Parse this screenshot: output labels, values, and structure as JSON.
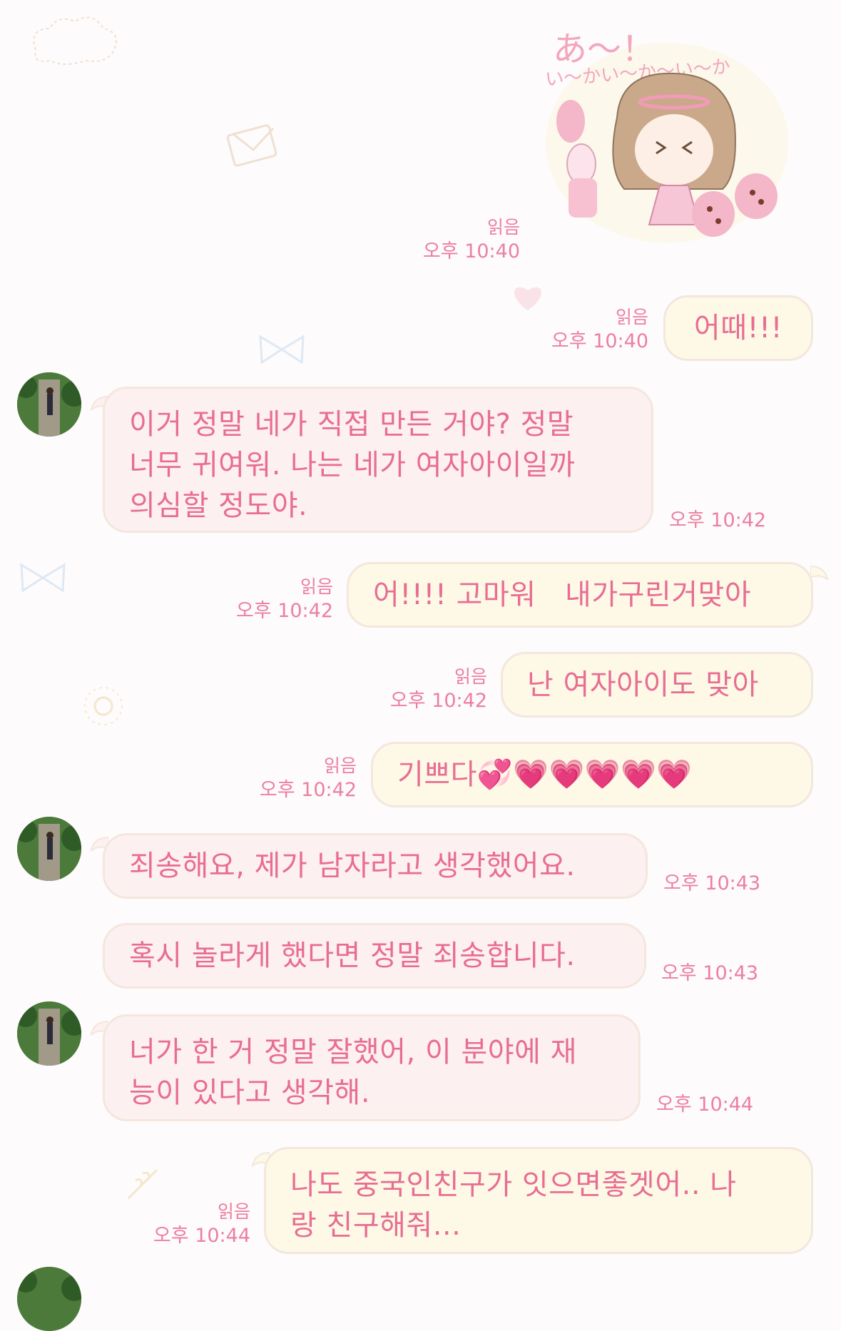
{
  "colors": {
    "text_pink": "#e86d93",
    "meta_pink": "#ec7fa2",
    "outgoing_bg": "#fdf9e6",
    "incoming_bg": "#fdf0f1",
    "bubble_border": "#f3e7de"
  },
  "sticker": {
    "caption_top": "あ〜！",
    "caption": "い〜かい〜か〜い〜か"
  },
  "messages": [
    {
      "id": "m0",
      "side": "out",
      "type": "sticker",
      "read": "읽음",
      "time": "오후 10:40"
    },
    {
      "id": "m1",
      "side": "out",
      "text": "어때!!!",
      "read": "읽음",
      "time": "오후 10:40"
    },
    {
      "id": "m2",
      "side": "in",
      "lines": [
        "이거 정말 네가 직접 만든 거야? 정말",
        "너무 귀여워. 나는 네가 여자아이일까",
        "의심할 정도야."
      ],
      "time": "오후 10:42"
    },
    {
      "id": "m3",
      "side": "out",
      "text": "어!!!! 고마워　내가구린거맞아",
      "read": "읽음",
      "time": "오후 10:42"
    },
    {
      "id": "m4",
      "side": "out",
      "text": "난 여자아이도 맞아",
      "read": "읽음",
      "time": "오후 10:42"
    },
    {
      "id": "m5",
      "side": "out",
      "text": "기쁘다💞💗💗💗💗💗",
      "read": "읽음",
      "time": "오후 10:42"
    },
    {
      "id": "m6",
      "side": "in",
      "text": "죄송해요, 제가 남자라고 생각했어요.",
      "time": "오후 10:43"
    },
    {
      "id": "m7",
      "side": "in",
      "text": "혹시 놀라게 했다면 정말 죄송합니다.",
      "time": "오후 10:43"
    },
    {
      "id": "m8",
      "side": "in",
      "lines": [
        "너가 한 거 정말 잘했어, 이 분야에 재",
        "능이 있다고 생각해."
      ],
      "time": "오후 10:44"
    },
    {
      "id": "m9",
      "side": "out",
      "lines": [
        "나도 중국인친구가 잇으면좋겟어.. 나",
        "랑 친구해줘..."
      ],
      "read": "읽음",
      "time": "오후 10:44"
    }
  ]
}
